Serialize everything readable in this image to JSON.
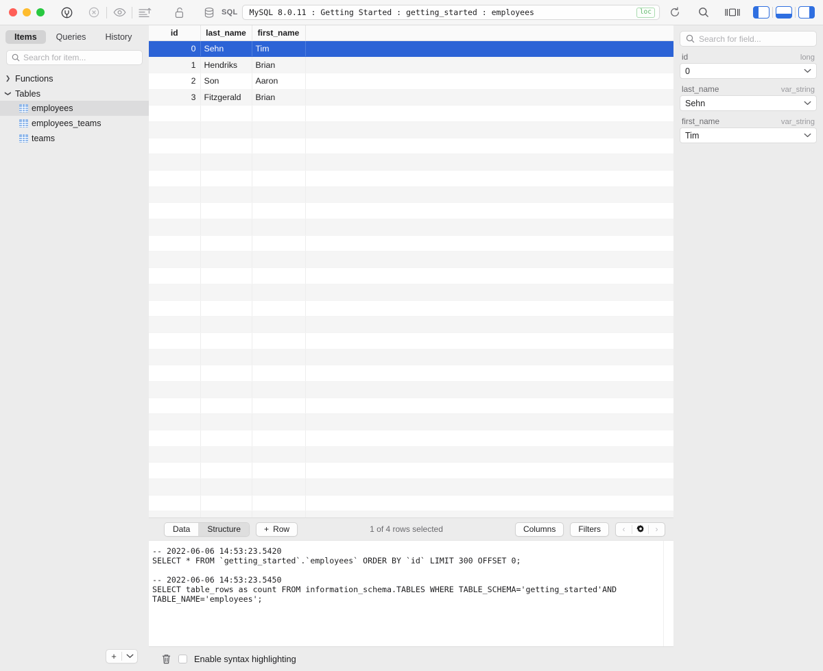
{
  "window": {
    "path": "MySQL 8.0.11 : Getting Started : getting_started : employees",
    "badge": "loc",
    "sql_label": "SQL"
  },
  "toolbar": {
    "icons": [
      "connect-icon",
      "disconnect-icon",
      "eye-icon",
      "sort-export-icon",
      "unlock-icon",
      "database-icon",
      "refresh-icon",
      "search-icon",
      "center-panel-icon",
      "left-panel-icon",
      "bottom-panel-icon",
      "right-panel-icon"
    ]
  },
  "sidebar": {
    "tabs": [
      {
        "label": "Items",
        "active": true
      },
      {
        "label": "Queries",
        "active": false
      },
      {
        "label": "History",
        "active": false
      }
    ],
    "search_placeholder": "Search for item...",
    "search_value": "",
    "groups": [
      {
        "label": "Functions",
        "expanded": false
      },
      {
        "label": "Tables",
        "expanded": true
      }
    ],
    "tables": [
      {
        "label": "employees",
        "selected": true
      },
      {
        "label": "employees_teams",
        "selected": false
      },
      {
        "label": "teams",
        "selected": false
      }
    ],
    "add_button": "+",
    "add_menu": "⌄"
  },
  "grid": {
    "columns": [
      "id",
      "last_name",
      "first_name",
      ""
    ],
    "rows": [
      {
        "id": "0",
        "last_name": "Sehn",
        "first_name": "Tim",
        "selected": true
      },
      {
        "id": "1",
        "last_name": "Hendriks",
        "first_name": "Brian",
        "selected": false
      },
      {
        "id": "2",
        "last_name": "Son",
        "first_name": "Aaron",
        "selected": false
      },
      {
        "id": "3",
        "last_name": "Fitzgerald",
        "first_name": "Brian",
        "selected": false
      }
    ],
    "empty_row_count": 27
  },
  "bottom_toolbar": {
    "data_label": "Data",
    "structure_label": "Structure",
    "add_row_label": "Row",
    "add_row_icon": "+",
    "rows_selected": "1 of 4 rows selected",
    "columns_label": "Columns",
    "filters_label": "Filters",
    "prev_icon": "‹",
    "gear_icon": "⚙",
    "next_icon": "›"
  },
  "log": {
    "text": "-- 2022-06-06 14:53:23.5420\nSELECT * FROM `getting_started`.`employees` ORDER BY `id` LIMIT 300 OFFSET 0;\n\n-- 2022-06-06 14:53:23.5450\nSELECT table_rows as count FROM information_schema.TABLES WHERE TABLE_SCHEMA='getting_started'AND\nTABLE_NAME='employees';"
  },
  "inspector": {
    "search_placeholder": "Search for field...",
    "search_value": "",
    "fields": [
      {
        "name": "id",
        "type": "long",
        "value": "0"
      },
      {
        "name": "last_name",
        "type": "var_string",
        "value": "Sehn"
      },
      {
        "name": "first_name",
        "type": "var_string",
        "value": "Tim"
      }
    ]
  },
  "statusbar": {
    "trash_icon": "trash-icon",
    "checkbox_checked": false,
    "checkbox_label": "Enable syntax highlighting"
  }
}
